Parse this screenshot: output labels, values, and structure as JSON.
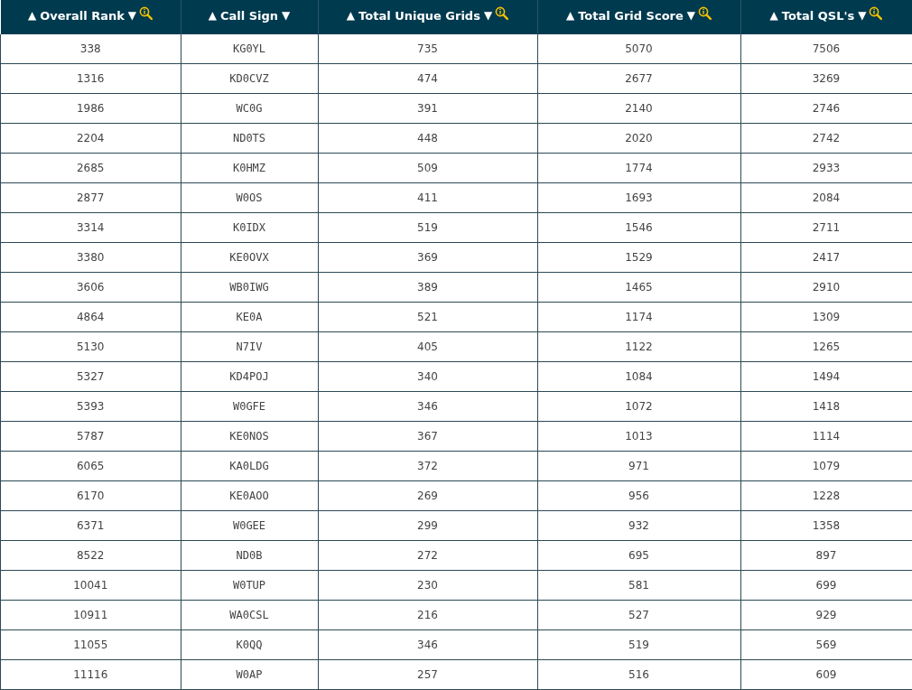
{
  "table": {
    "columns": [
      {
        "sort_up": "▲",
        "label": "Overall Rank",
        "sort_down": "▼",
        "info": true,
        "kind": "number"
      },
      {
        "sort_up": "▲",
        "label": "Call Sign",
        "sort_down": "▼",
        "info": false,
        "kind": "callsign"
      },
      {
        "sort_up": "▲",
        "label": "Total Unique Grids",
        "sort_down": "▼",
        "info": true,
        "kind": "number"
      },
      {
        "sort_up": "▲",
        "label": "Total Grid Score",
        "sort_down": "▼",
        "info": true,
        "kind": "number"
      },
      {
        "sort_up": "▲",
        "label": "Total QSL's",
        "sort_down": "▼",
        "info": true,
        "kind": "number"
      }
    ],
    "rows": [
      [
        "338",
        "KG0YL",
        "735",
        "5070",
        "7506"
      ],
      [
        "1316",
        "KD0CVZ",
        "474",
        "2677",
        "3269"
      ],
      [
        "1986",
        "WC0G",
        "391",
        "2140",
        "2746"
      ],
      [
        "2204",
        "ND0TS",
        "448",
        "2020",
        "2742"
      ],
      [
        "2685",
        "K0HMZ",
        "509",
        "1774",
        "2933"
      ],
      [
        "2877",
        "W0OS",
        "411",
        "1693",
        "2084"
      ],
      [
        "3314",
        "K0IDX",
        "519",
        "1546",
        "2711"
      ],
      [
        "3380",
        "KE0OVX",
        "369",
        "1529",
        "2417"
      ],
      [
        "3606",
        "WB0IWG",
        "389",
        "1465",
        "2910"
      ],
      [
        "4864",
        "KE0A",
        "521",
        "1174",
        "1309"
      ],
      [
        "5130",
        "N7IV",
        "405",
        "1122",
        "1265"
      ],
      [
        "5327",
        "KD4POJ",
        "340",
        "1084",
        "1494"
      ],
      [
        "5393",
        "W0GFE",
        "346",
        "1072",
        "1418"
      ],
      [
        "5787",
        "KE0NOS",
        "367",
        "1013",
        "1114"
      ],
      [
        "6065",
        "KA0LDG",
        "372",
        "971",
        "1079"
      ],
      [
        "6170",
        "KE0AOO",
        "269",
        "956",
        "1228"
      ],
      [
        "6371",
        "W0GEE",
        "299",
        "932",
        "1358"
      ],
      [
        "8522",
        "ND0B",
        "272",
        "695",
        "897"
      ],
      [
        "10041",
        "W0TUP",
        "230",
        "581",
        "699"
      ],
      [
        "10911",
        "WA0CSL",
        "216",
        "527",
        "929"
      ],
      [
        "11055",
        "K0QQ",
        "346",
        "519",
        "569"
      ],
      [
        "11116",
        "W0AP",
        "257",
        "516",
        "609"
      ]
    ]
  }
}
